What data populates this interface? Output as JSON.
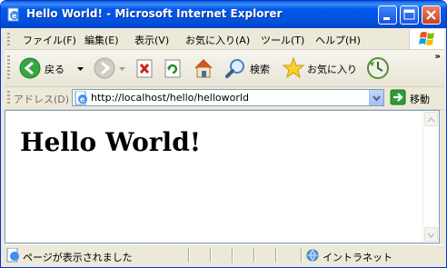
{
  "window": {
    "title": "Hello World! - Microsoft Internet Explorer",
    "icon": "ie-page-icon"
  },
  "menu": {
    "items": [
      "ファイル(F)",
      "編集(E)",
      "表示(V)",
      "お気に入り(A)",
      "ツール(T)",
      "ヘルプ(H)"
    ]
  },
  "toolbar": {
    "back_label": "戻る",
    "search_label": "検索",
    "favorites_label": "お気に入り",
    "overflow": "»"
  },
  "address": {
    "label": "アドレス(D)",
    "url": "http://localhost/hello/helloworld",
    "go_label": "移動"
  },
  "page": {
    "heading": "Hello World!"
  },
  "status": {
    "text": "ページが表示されました",
    "zone": "イントラネット"
  },
  "colors": {
    "titlebar": "#0058ee",
    "chrome": "#ece9d8",
    "close_button": "#c4431f",
    "back_arrow": "#3aa640",
    "go_arrow": "#2e9d34"
  }
}
